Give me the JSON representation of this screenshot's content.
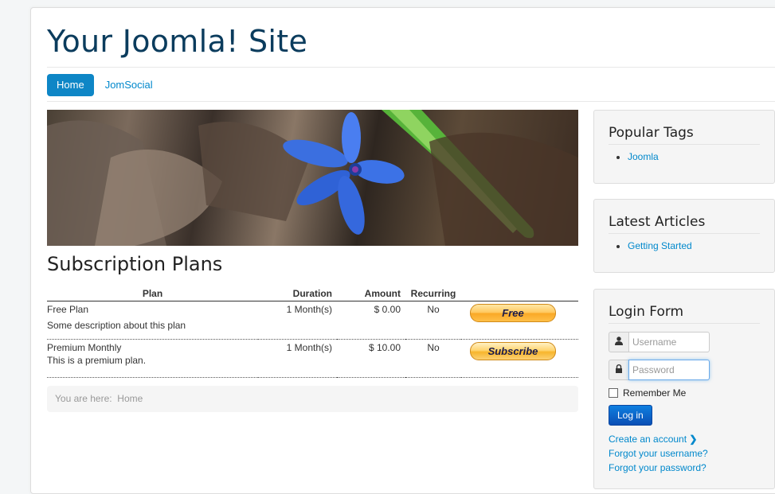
{
  "site_title": "Your Joomla! Site",
  "nav": {
    "items": [
      "Home",
      "JomSocial"
    ],
    "active": 0
  },
  "page_title": "Subscription Plans",
  "table": {
    "headers": [
      "Plan",
      "Duration",
      "Amount",
      "Recurring"
    ],
    "rows": [
      {
        "plan": "Free Plan",
        "description": "Some description about this plan",
        "duration": "1 Month(s)",
        "amount": "$ 0.00",
        "recurring": "No",
        "button": "Free"
      },
      {
        "plan": "Premium Monthly",
        "description": "This is a premium plan.",
        "duration": "1 Month(s)",
        "amount": "$ 10.00",
        "recurring": "No",
        "button": "Subscribe"
      }
    ]
  },
  "breadcrumbs": {
    "label": "You are here:",
    "current": "Home"
  },
  "popular_tags": {
    "title": "Popular Tags",
    "items": [
      "Joomla"
    ]
  },
  "latest_articles": {
    "title": "Latest Articles",
    "items": [
      "Getting Started"
    ]
  },
  "login": {
    "title": "Login Form",
    "username_placeholder": "Username",
    "password_placeholder": "Password",
    "remember": "Remember Me",
    "button": "Log in",
    "create": "Create an account",
    "forgot_username": "Forgot your username?",
    "forgot_password": "Forgot your password?"
  },
  "colors": {
    "accent": "#0e86c6",
    "title": "#0b3c5d",
    "link": "#0088cc"
  },
  "icons": {
    "user": "user-icon",
    "lock": "lock-icon",
    "chevron": "chevron-right-icon"
  }
}
